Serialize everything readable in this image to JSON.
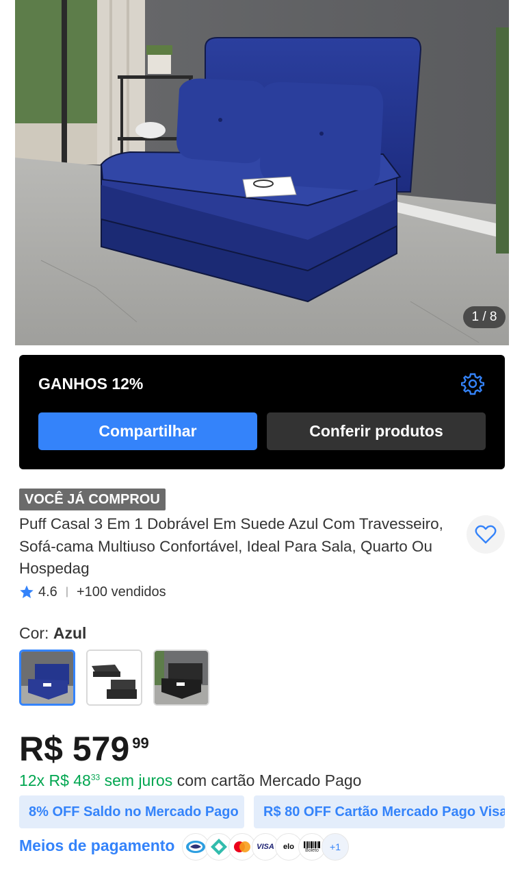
{
  "gallery": {
    "counter": "1 / 8"
  },
  "affiliate": {
    "title": "GANHOS 12%",
    "share_label": "Compartilhar",
    "check_label": "Conferir produtos"
  },
  "product": {
    "badge": "VOCÊ JÁ COMPROU",
    "title": "Puff Casal 3 Em 1 Dobrável Em Suede Azul Com Travesseiro, Sofá-cama Multiuso Confortável, Ideal Para Sala, Quarto Ou Hospedag",
    "rating": "4.6",
    "sold": "+100 vendidos"
  },
  "color": {
    "label": "Cor:",
    "value": "Azul",
    "options": [
      "blue",
      "black-studio",
      "black-room"
    ],
    "selected": 0
  },
  "pricing": {
    "currency": "R$",
    "integer": "579",
    "cents": "99",
    "installments_prefix": "12x R$ 48",
    "installments_cents": "33",
    "installments_suffix": "sem juros",
    "installments_card": "com cartão Mercado Pago"
  },
  "promos": [
    "8% OFF Saldo no Mercado Pago",
    "R$ 80 OFF Cartão Mercado Pago Visa"
  ],
  "payment": {
    "label": "Meios de pagamento",
    "icons": [
      "mercadopago-icon",
      "pix-icon",
      "mastercard-icon",
      "visa-icon",
      "elo-icon",
      "boleto-icon"
    ],
    "visa": "VISA",
    "elo": "elo",
    "boleto": "Boleto",
    "more": "+1"
  },
  "colors": {
    "accent": "#3483fa",
    "green": "#00a650",
    "panel": "#000000",
    "sofa": "#1f2f8a"
  }
}
